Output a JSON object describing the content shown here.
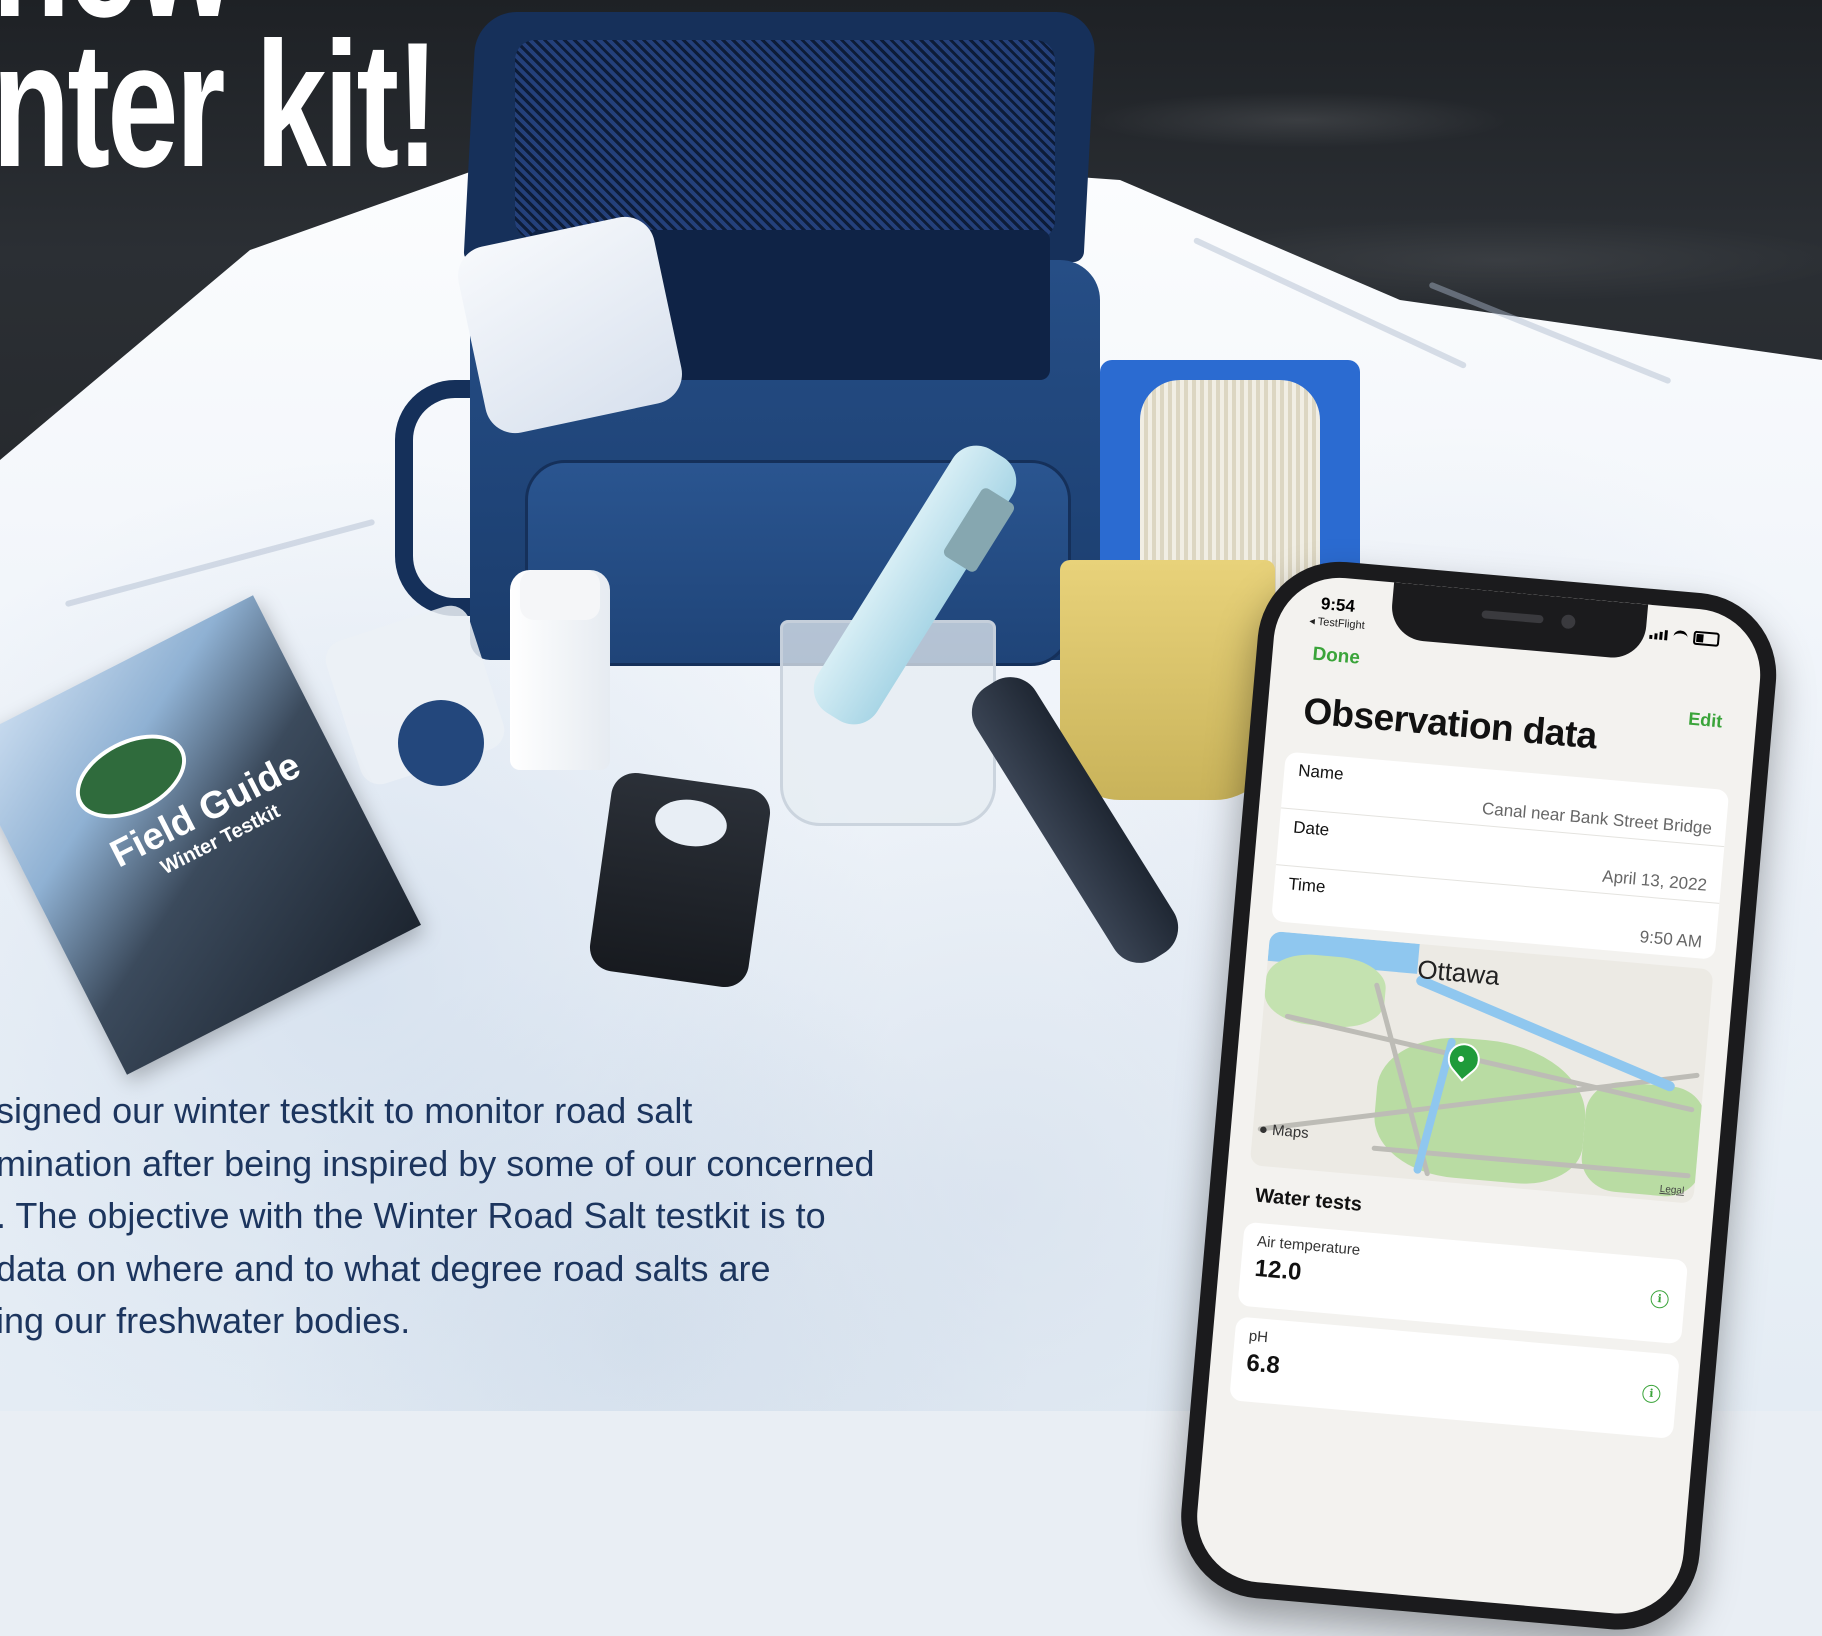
{
  "headline": {
    "line1": "new",
    "line2": "nter kit!"
  },
  "paragraph": {
    "lines": [
      "signed our winter testkit to monitor road salt",
      "mination after being inspired by some of our concerned",
      ". The objective with the Winter Road Salt testkit is to",
      "data on where and to what degree road salts are",
      "ing our freshwater bodies."
    ]
  },
  "field_guide": {
    "title": "Field Guide",
    "subtitle": "Winter Testkit"
  },
  "phone": {
    "status": {
      "time": "9:54",
      "back_app": "◂ TestFlight"
    },
    "nav": {
      "done_label": "Done",
      "edit_label": "Edit"
    },
    "title": "Observation data",
    "fields": [
      {
        "label": "Name",
        "value": "Canal near Bank Street Bridge"
      },
      {
        "label": "Date",
        "value": "April 13, 2022"
      },
      {
        "label": "Time",
        "value": "9:50 AM"
      }
    ],
    "map": {
      "city_label": "Ottawa",
      "attribution": "Maps",
      "legal": "Legal"
    },
    "water_tests": {
      "title": "Water tests",
      "items": [
        {
          "label": "Air temperature",
          "value": "12.0"
        },
        {
          "label": "pH",
          "value": "6.8"
        }
      ]
    }
  },
  "colors": {
    "headline": "#ffffff",
    "paragraph": "#1c355e",
    "accent_green": "#3aa43a"
  }
}
